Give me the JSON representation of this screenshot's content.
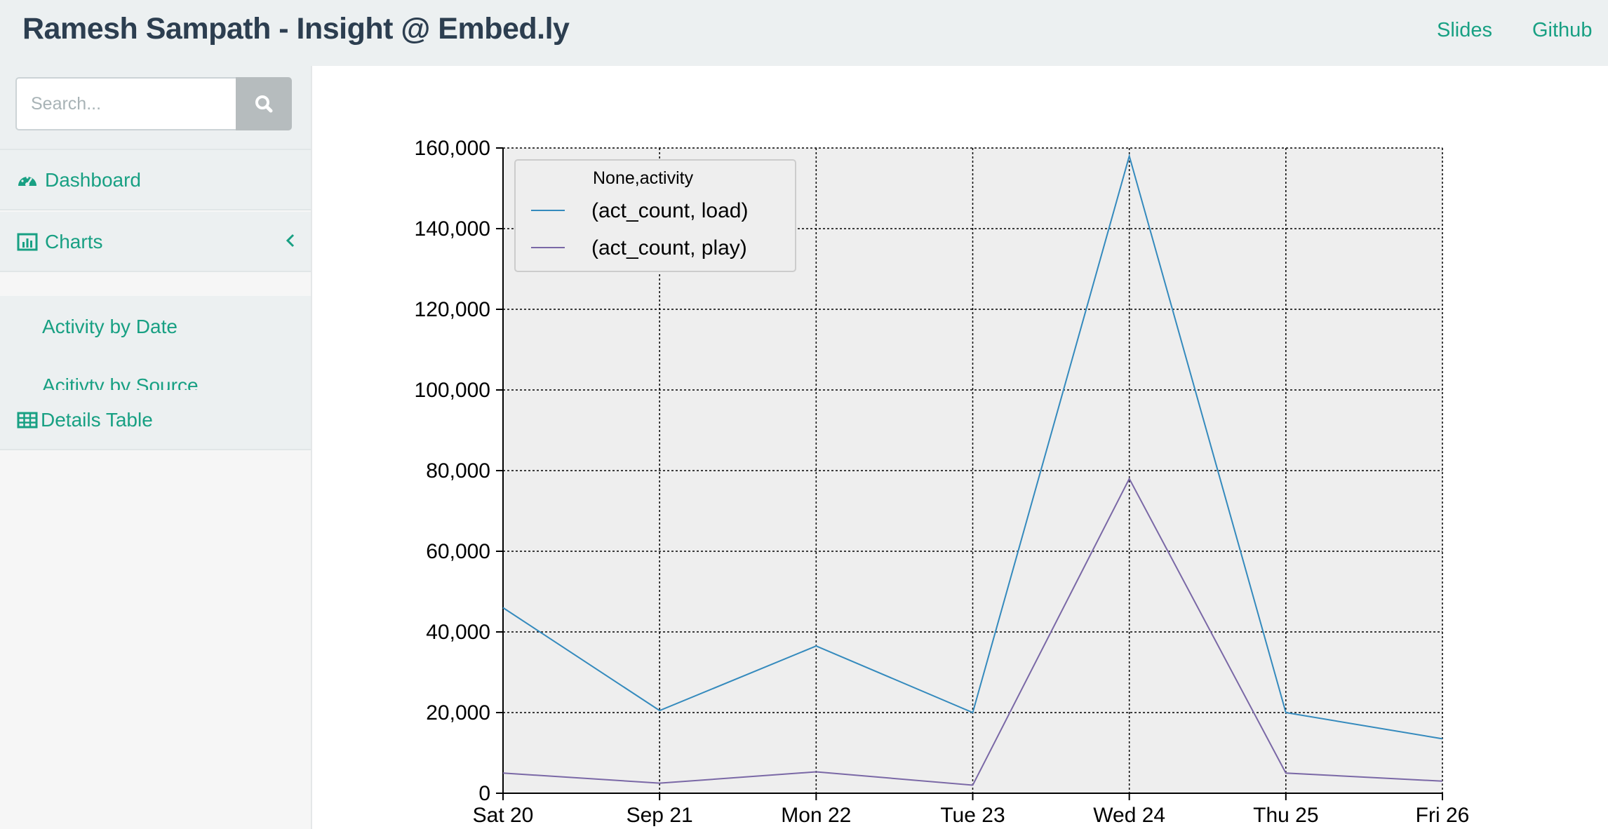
{
  "navbar": {
    "brand": "Ramesh Sampath - Insight @ Embed.ly",
    "links": [
      "Slides",
      "Github"
    ]
  },
  "sidebar": {
    "search": {
      "placeholder": "Search...",
      "value": ""
    },
    "items": [
      {
        "label": "Dashboard",
        "icon": "dashboard-icon"
      },
      {
        "label": "Charts",
        "icon": "bar-chart-icon",
        "expanded": true
      },
      {
        "label": "Details Table",
        "icon": "table-icon"
      }
    ],
    "charts_submenu": [
      "Activity by Date",
      "Acitivty by Source"
    ]
  },
  "chart_data": {
    "type": "line",
    "categories": [
      "Sat 20",
      "Sep 21",
      "Mon 22",
      "Tue 23",
      "Wed 24",
      "Thu 25",
      "Fri 26"
    ],
    "series": [
      {
        "name": "(act_count, load)",
        "values": [
          46000,
          20500,
          36500,
          20000,
          158000,
          20000,
          13500
        ],
        "color": "#348abd"
      },
      {
        "name": "(act_count, play)",
        "values": [
          5000,
          2500,
          5300,
          2000,
          78000,
          5000,
          3000
        ],
        "color": "#7a68a6"
      }
    ],
    "legend_title": "None,activity",
    "legend_position": "top-left",
    "ylim": [
      0,
      160000
    ],
    "yticks": [
      "0",
      "20,000",
      "40,000",
      "60,000",
      "80,000",
      "100,000",
      "120,000",
      "140,000",
      "160,000"
    ],
    "grid": true,
    "background": "#eeeeee"
  },
  "colors": {
    "accent": "#18a083",
    "brand": "#2c3e50",
    "navbar_bg": "#ecf0f1"
  }
}
